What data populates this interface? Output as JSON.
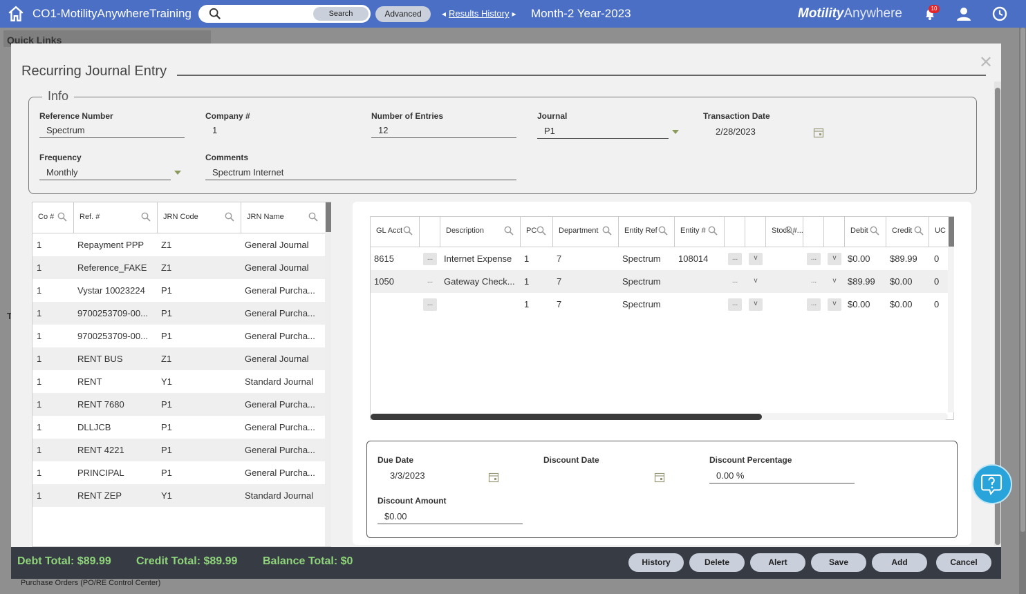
{
  "topbar": {
    "title": "CO1-MotilityAnywhereTraining",
    "search_placeholder": "",
    "search_button": "Search",
    "advanced_button": "Advanced",
    "results_history": "Results History",
    "period": "Month-2 Year-2023",
    "brand_bold": "Motility",
    "brand_light": "Anywhere",
    "notification_count": "10"
  },
  "background": {
    "quick_links": "Quick Links",
    "footer_text": "Purchase Orders (PO/RE Control Center)",
    "t_letter": "T"
  },
  "modal": {
    "title": "Recurring Journal Entry",
    "info_legend": "Info",
    "fields": {
      "reference_number": {
        "label": "Reference Number",
        "value": "Spectrum"
      },
      "company": {
        "label": "Company #",
        "value": "1"
      },
      "number_of_entries": {
        "label": "Number of Entries",
        "value": "12"
      },
      "journal": {
        "label": "Journal",
        "value": "P1"
      },
      "transaction_date": {
        "label": "Transaction Date",
        "value": "2/28/2023"
      },
      "frequency": {
        "label": "Frequency",
        "value": "Monthly"
      },
      "comments": {
        "label": "Comments",
        "value": "Spectrum Internet"
      }
    },
    "left_grid": {
      "headers": [
        "Co #",
        "Ref. #",
        "JRN Code",
        "JRN Name"
      ],
      "rows": [
        [
          "1",
          "Repayment PPP",
          "Z1",
          "General Journal"
        ],
        [
          "1",
          "Reference_FAKE",
          "Z1",
          "General Journal"
        ],
        [
          "1",
          "Vystar 10023224",
          "P1",
          "General Purcha..."
        ],
        [
          "1",
          "9700253709-00...",
          "P1",
          "General Purcha..."
        ],
        [
          "1",
          "9700253709-00...",
          "P1",
          "General Purcha..."
        ],
        [
          "1",
          "RENT BUS",
          "Z1",
          "General Journal"
        ],
        [
          "1",
          "RENT",
          "Y1",
          "Standard Journal"
        ],
        [
          "1",
          "RENT 7680",
          "P1",
          "General Purcha..."
        ],
        [
          "1",
          "DLLJCB",
          "P1",
          "General Purcha..."
        ],
        [
          "1",
          "RENT 4221",
          "P1",
          "General Purcha..."
        ],
        [
          "1",
          "PRINCIPAL",
          "P1",
          "General Purcha..."
        ],
        [
          "1",
          "RENT ZEP",
          "Y1",
          "Standard Journal"
        ]
      ]
    },
    "right_grid": {
      "headers": {
        "gl_acct": "GL Acct",
        "description": "Description",
        "pc": "PC",
        "department": "Department",
        "entity_ref": "Entity Ref",
        "entity_num": "Entity #",
        "stock": "Stock #...",
        "debit": "Debit",
        "credit": "Credit",
        "uc": "UC"
      },
      "rows": [
        {
          "gl": "8615",
          "desc": "Internet Expense",
          "pc": "1",
          "dept": "7",
          "eref": "Spectrum",
          "enum": "108014",
          "debit": "$0.00",
          "credit": "$89.99",
          "uc": "0"
        },
        {
          "gl": "1050",
          "desc": "Gateway Check...",
          "pc": "1",
          "dept": "7",
          "eref": "Spectrum",
          "enum": "",
          "debit": "$89.99",
          "credit": "$0.00",
          "uc": "0"
        },
        {
          "gl": "",
          "desc": "",
          "pc": "1",
          "dept": "7",
          "eref": "Spectrum",
          "enum": "",
          "debit": "$0.00",
          "credit": "$0.00",
          "uc": "0"
        }
      ],
      "ellipsis": "...",
      "v": "v"
    },
    "due": {
      "due_date": {
        "label": "Due Date",
        "value": "3/3/2023"
      },
      "discount_date": {
        "label": "Discount Date",
        "value": ""
      },
      "discount_percentage": {
        "label": "Discount Percentage",
        "value": "0.00 %"
      },
      "discount_amount": {
        "label": "Discount Amount",
        "value": "$0.00"
      }
    },
    "footer": {
      "debt_total": "Debt Total: $89.99",
      "credit_total": "Credit Total: $89.99",
      "balance_total": "Balance Total: $0",
      "buttons": {
        "history": "History",
        "delete": "Delete",
        "alert": "Alert",
        "save": "Save",
        "add": "Add",
        "cancel": "Cancel"
      }
    }
  },
  "colors": {
    "topbar": "#4a6fc4",
    "footer": "#363b44",
    "totals": "#8fd47a",
    "help": "#29a4da"
  }
}
